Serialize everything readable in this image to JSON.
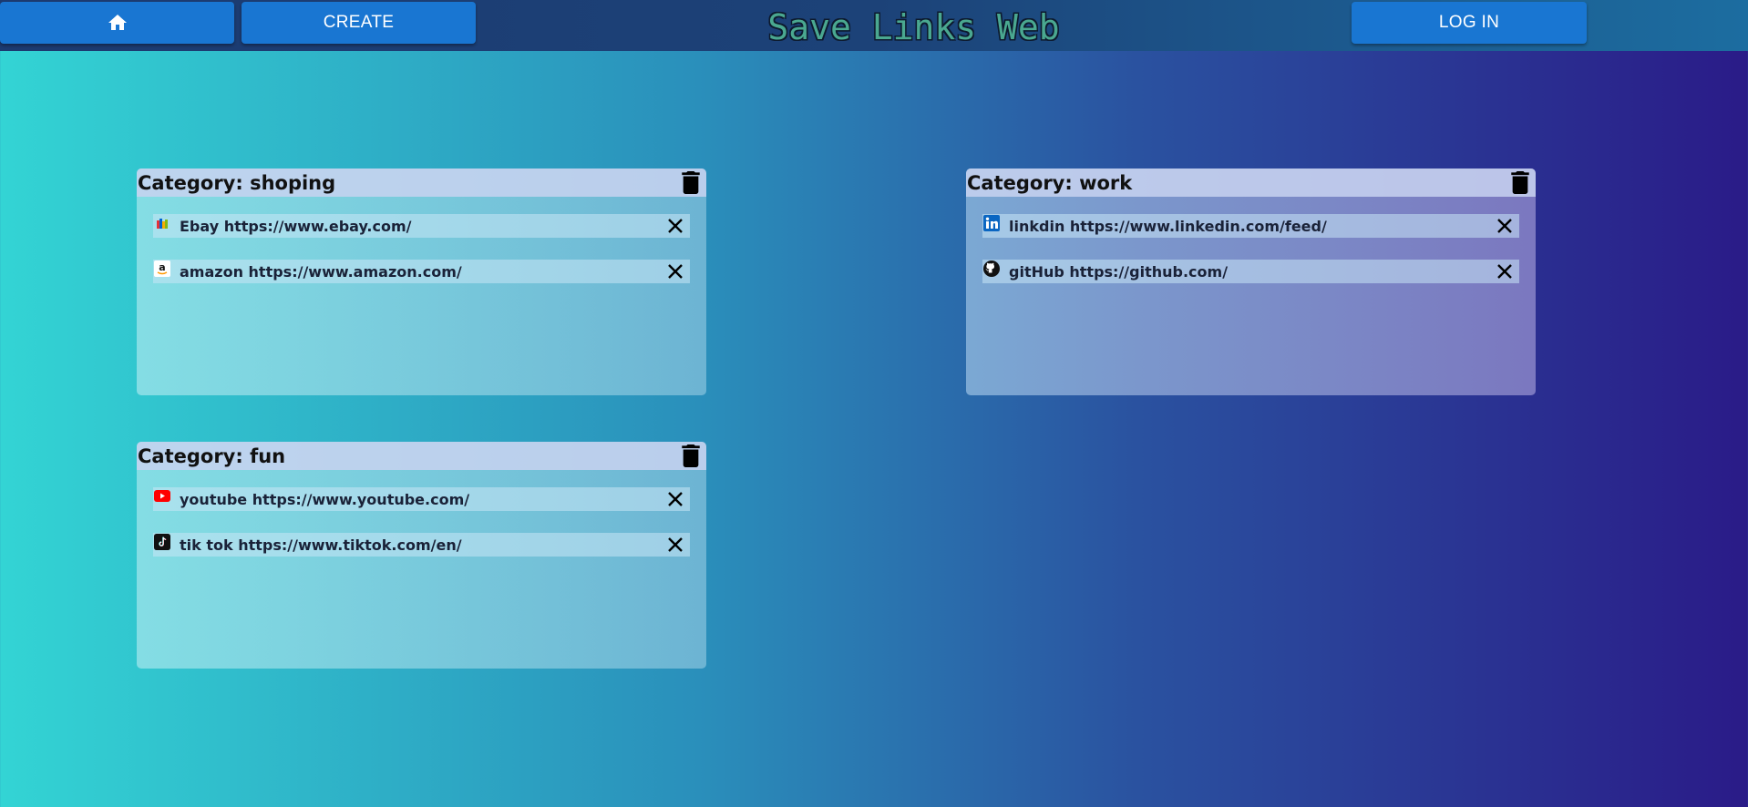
{
  "nav": {
    "home_icon": "home-icon",
    "create_label": "CREATE",
    "login_label": "LOG IN"
  },
  "brand": {
    "title": "Save Links Web"
  },
  "categories": [
    {
      "title": "Category: shoping",
      "links": [
        {
          "icon": "ebay-icon",
          "text": "Ebay https://www.ebay.com/"
        },
        {
          "icon": "amazon-icon",
          "text": "amazon https://www.amazon.com/"
        }
      ]
    },
    {
      "title": "Category: work",
      "links": [
        {
          "icon": "linkedin-icon",
          "text": "linkdin https://www.linkedin.com/feed/"
        },
        {
          "icon": "github-icon",
          "text": "gitHub https://github.com/"
        }
      ]
    },
    {
      "title": "Category: fun",
      "links": [
        {
          "icon": "youtube-icon",
          "text": "youtube https://www.youtube.com/"
        },
        {
          "icon": "tiktok-icon",
          "text": "tik tok https://www.tiktok.com/en/"
        }
      ]
    }
  ]
}
